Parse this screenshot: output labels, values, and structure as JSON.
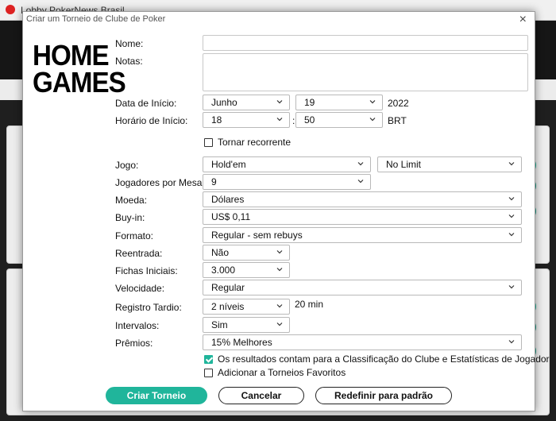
{
  "window": {
    "bg_title": "Lobby PokerNews Brasil",
    "dialog_title": "Criar um Torneio de Clube de Poker",
    "close_glyph": "×"
  },
  "logo": {
    "line1": "HOME",
    "line2": "GAMES"
  },
  "form": {
    "nome_label": "Nome:",
    "nome_value": "",
    "notas_label": "Notas:",
    "notas_value": "",
    "data_label": "Data de Início:",
    "data_mes": "Junho",
    "data_dia": "19",
    "data_ano": "2022",
    "hora_label": "Horário de Início:",
    "hora_h": "18",
    "hora_sep": ":",
    "hora_m": "50",
    "hora_tz": "BRT",
    "recorrente_label": "Tornar recorrente",
    "recorrente_checked": false,
    "jogo_label": "Jogo:",
    "jogo_value": "Hold'em",
    "limite_value": "No Limit",
    "jogadores_label": "Jogadores por Mesa:",
    "jogadores_value": "9",
    "moeda_label": "Moeda:",
    "moeda_value": "Dólares",
    "buyin_label": "Buy-in:",
    "buyin_value": "US$ 0,11",
    "formato_label": "Formato:",
    "formato_value": "Regular - sem rebuys",
    "reentrada_label": "Reentrada:",
    "reentrada_value": "Não",
    "fichas_label": "Fichas Iniciais:",
    "fichas_value": "3.000",
    "velocidade_label": "Velocidade:",
    "velocidade_value": "Regular",
    "registro_label": "Registro Tardio:",
    "registro_value": "2 níveis",
    "registro_extra": "20 min",
    "intervalos_label": "Intervalos:",
    "intervalos_value": "Sim",
    "premios_label": "Prêmios:",
    "premios_value": "15% Melhores",
    "resultados_label": "Os resultados contam para a Classificação do Clube e Estatísticas de Jogador",
    "resultados_checked": true,
    "favoritos_label": "Adicionar a Torneios Favoritos",
    "favoritos_checked": false
  },
  "buttons": {
    "criar": "Criar Torneio",
    "cancelar": "Cancelar",
    "redefinir": "Redefinir para padrão"
  },
  "colors": {
    "accent": "#20b59b",
    "text": "#111111",
    "border": "#b9b9b9"
  },
  "icons": [
    "close-icon",
    "chevron-down-icon",
    "check-icon",
    "scroll-arrow-icon"
  ]
}
